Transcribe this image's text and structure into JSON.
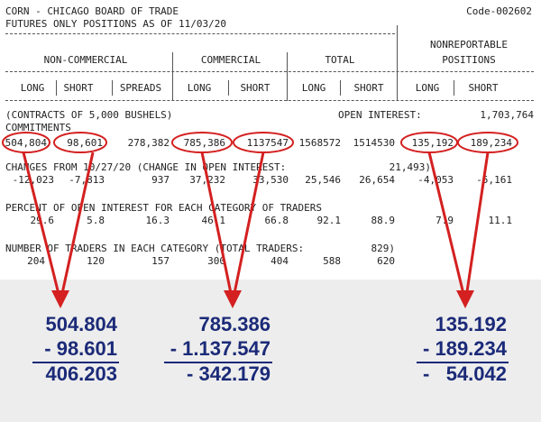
{
  "report": {
    "title": "CORN - CHICAGO BOARD OF TRADE",
    "code": "Code-002602",
    "subtitle": "FUTURES ONLY POSITIONS AS OF 11/03/20",
    "groups": {
      "noncommercial": "NON-COMMERCIAL",
      "commercial": "COMMERCIAL",
      "total": "TOTAL",
      "nonreportable_line1": "NONREPORTABLE",
      "nonreportable_line2": "POSITIONS"
    },
    "columns": [
      "LONG",
      "SHORT",
      "SPREADS",
      "LONG",
      "SHORT",
      "LONG",
      "SHORT",
      "LONG",
      "SHORT"
    ],
    "contracts_note": "(CONTRACTS OF 5,000 BUSHELS)",
    "open_interest_label": "OPEN INTEREST:",
    "open_interest_value": "1,703,764",
    "commitments_label": "COMMITMENTS",
    "commitments": [
      "504,804",
      "98,601",
      "278,382",
      "785,386",
      "1137547",
      "1568572",
      "1514530",
      "135,192",
      "189,234"
    ],
    "changes_label": "CHANGES FROM 10/27/20 (CHANGE IN OPEN INTEREST:",
    "changes_oi_value": "21,493)",
    "changes": [
      "-12,023",
      "-7,813",
      "937",
      "37,232",
      "33,530",
      "25,546",
      "26,654",
      "-4,053",
      "-5,161"
    ],
    "percent_label": "PERCENT OF OPEN INTEREST FOR EACH CATEGORY OF TRADERS",
    "percent": [
      "29.6",
      "5.8",
      "16.3",
      "46.1",
      "66.8",
      "92.1",
      "88.9",
      "7.9",
      "11.1"
    ],
    "traders_label": "NUMBER OF TRADERS IN EACH CATEGORY (TOTAL TRADERS:",
    "traders_total": "829)",
    "traders": [
      "204",
      "120",
      "157",
      "300",
      "404",
      "588",
      "620"
    ]
  },
  "calculations": {
    "noncommercial": {
      "long": "504.804",
      "short": "- 98.601",
      "net": "406.203"
    },
    "commercial": {
      "long": "785.386",
      "short": "- 1.137.547",
      "net": "- 342.179"
    },
    "nonreportable": {
      "long": "135.192",
      "short": "- 189.234",
      "net": "-   54.042"
    }
  },
  "colors": {
    "annotation_red": "#d42020",
    "calc_blue": "#1b2a78",
    "panel_gray": "#ededed",
    "text": "#222222"
  }
}
